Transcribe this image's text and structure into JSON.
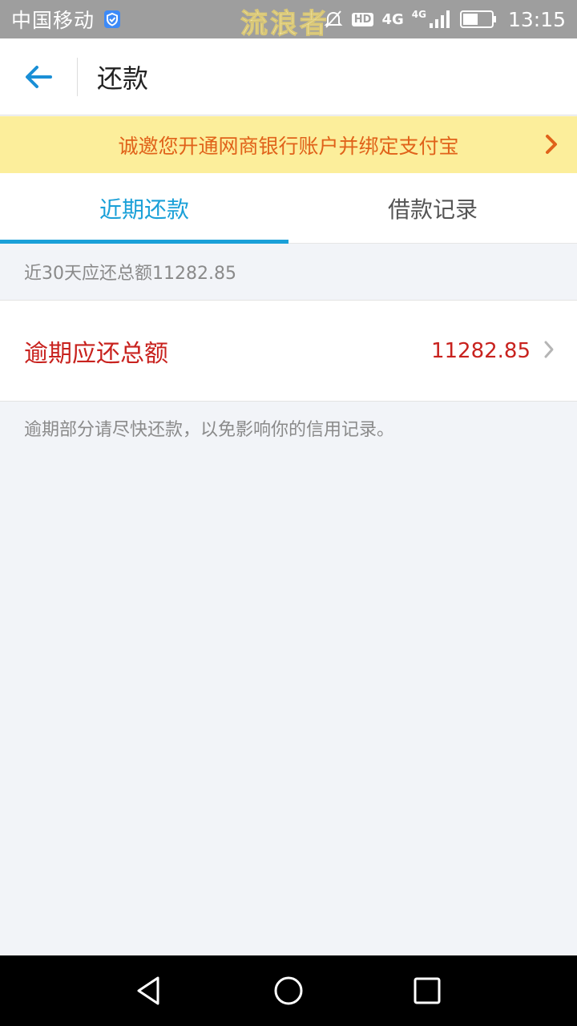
{
  "status_bar": {
    "carrier": "中国移动",
    "watermark": "流浪者",
    "hd": "HD",
    "network_primary": "4G",
    "network_secondary": "4G",
    "time": "13:15"
  },
  "app_bar": {
    "title": "还款"
  },
  "banner": {
    "text": "诚邀您开通网商银行账户并绑定支付宝"
  },
  "tabs": [
    {
      "label": "近期还款",
      "active": true
    },
    {
      "label": "借款记录",
      "active": false
    }
  ],
  "summary": {
    "text": "近30天应还总额11282.85"
  },
  "overdue": {
    "label": "逾期应还总额",
    "amount": "11282.85"
  },
  "note": {
    "text": "逾期部分请尽快还款，以免影响你的信用记录。"
  },
  "colors": {
    "accent": "#1aa0d8",
    "overdue_red": "#c8221e",
    "banner_bg": "#fcee9b",
    "banner_text": "#e0621a"
  }
}
